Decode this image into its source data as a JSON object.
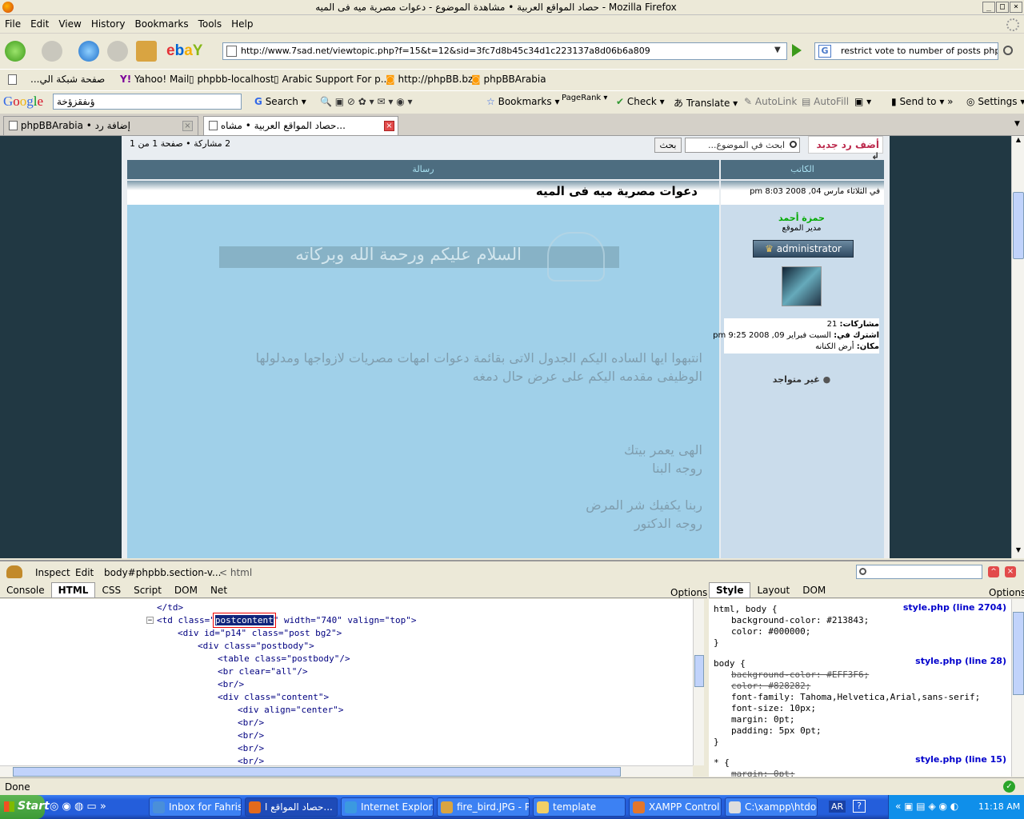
{
  "window": {
    "title": "حصاد المواقع العربية • مشاهدة الموضوع - دعوات مصرية ميه فى الميه - Mozilla Firefox"
  },
  "menu": [
    "File",
    "Edit",
    "View",
    "History",
    "Bookmarks",
    "Tools",
    "Help"
  ],
  "nav": {
    "url": "http://www.7sad.net/viewtopic.php?f=15&t=12&sid=3fc7d8b45c34d1c223137a8d06b6a809",
    "search_value": "restrict vote to number of posts phpbb"
  },
  "bookmarks": [
    "...صفحة شبكة الي",
    "Yahoo! Mail",
    "phpbb-localhost",
    "Arabic Support For p...",
    "http://phpBB.bz",
    "phpBBArabia"
  ],
  "google_toolbar": {
    "query": "ؤىفقزؤخة",
    "items": [
      "Search",
      "Bookmarks",
      "PageRank",
      "Check",
      "Translate",
      "AutoLink",
      "AutoFill",
      "Send to",
      "Settings"
    ]
  },
  "tabs": [
    {
      "label": "phpBBArabia • إضافة رد"
    },
    {
      "label": "حصاد المواقع العربية • مشاه..."
    }
  ],
  "forum": {
    "pagination": "2 مشاركة • صفحة 1 من 1",
    "search_button": "بحث",
    "search_placeholder": "ابحث في الموضوع...",
    "reply_button": "أضف رد جديد",
    "col_author": "الكاتب",
    "col_message": "رسالة",
    "post_date": "في الثلاثاء مارس 04, 2008 8:03 pm",
    "post_title": "دعوات مصرية ميه فى الميه",
    "author_name": "حمزة أحمد",
    "author_rank": "مدير الموقع",
    "rank_badge": "administrator",
    "posts_label": "مشاركات:",
    "posts_value": "21",
    "joined_label": "اشترك في:",
    "joined_value": "السبت فبراير 09, 2008 9:25 pm",
    "location_label": "مكان:",
    "location_value": "أرض الكنانه",
    "online_status": "غير متواجد",
    "banner_text": "السلام عليكم ورحمة الله وبركاته",
    "body_lines": [
      "انتبهوا ايها الساده اليكم الجدول الاتى بقائمة دعوات امهات مصريات لازواجها ومدلولها",
      "الوظيفى مقدمه اليكم على عرض حال دمغه",
      "",
      "",
      "",
      "الهى يعمر بيتك",
      "روجه البنا",
      "",
      "ربنا يكفيك شر المرض",
      "روجه الدكتور"
    ]
  },
  "firebug": {
    "toolbar": [
      "Inspect",
      "Edit"
    ],
    "breadcrumb": "body#phpbb.section-v...",
    "breadcrumb_next": "< html",
    "tabs": [
      "Console",
      "HTML",
      "CSS",
      "Script",
      "DOM",
      "Net"
    ],
    "options": "Options",
    "right_tabs": [
      "Style",
      "Layout",
      "DOM"
    ],
    "html_lines": [
      "</td>",
      "<td class=\"postcontent\" width=\"740\" valign=\"top\">",
      "<div id=\"p14\" class=\"post bg2\">",
      "<div class=\"postbody\">",
      "<table class=\"postbody\"/>",
      "<br clear=\"all\"/>",
      "<br/>",
      "<div class=\"content\">",
      "<div align=\"center\">",
      "<br/>",
      "<br/>",
      "<br/>",
      "<br/>"
    ],
    "css_rules": [
      {
        "selector": "html, body {",
        "source": "style.php (line 2704)",
        "props": [
          "background-color: #213843;",
          "color: #000000;"
        ],
        "struck": [
          false,
          false
        ]
      },
      {
        "selector": "body {",
        "source": "style.php (line 28)",
        "props": [
          "background-color: #EFF3F6;",
          "color: #828282;",
          "font-family: Tahoma,Helvetica,Arial,sans-serif;",
          "font-size: 10px;",
          "margin: 0pt;",
          "padding: 5px 0pt;"
        ],
        "struck": [
          true,
          true,
          false,
          false,
          false,
          false
        ]
      },
      {
        "selector": "* {",
        "source": "style.php (line 15)",
        "props": [
          "margin: 0pt;"
        ],
        "struck": [
          true
        ]
      }
    ]
  },
  "status": {
    "text": "Done"
  },
  "taskbar": {
    "start": "Start",
    "tasks": [
      "Inbox for Fahris...",
      "حصاد المواقع ا...",
      "Internet Explor...",
      "fire_bird.JPG - P...",
      "template",
      "XAMPP Control ...",
      "C:\\xampp\\htdoc..."
    ],
    "lang": "AR",
    "time": "11:18 AM"
  }
}
